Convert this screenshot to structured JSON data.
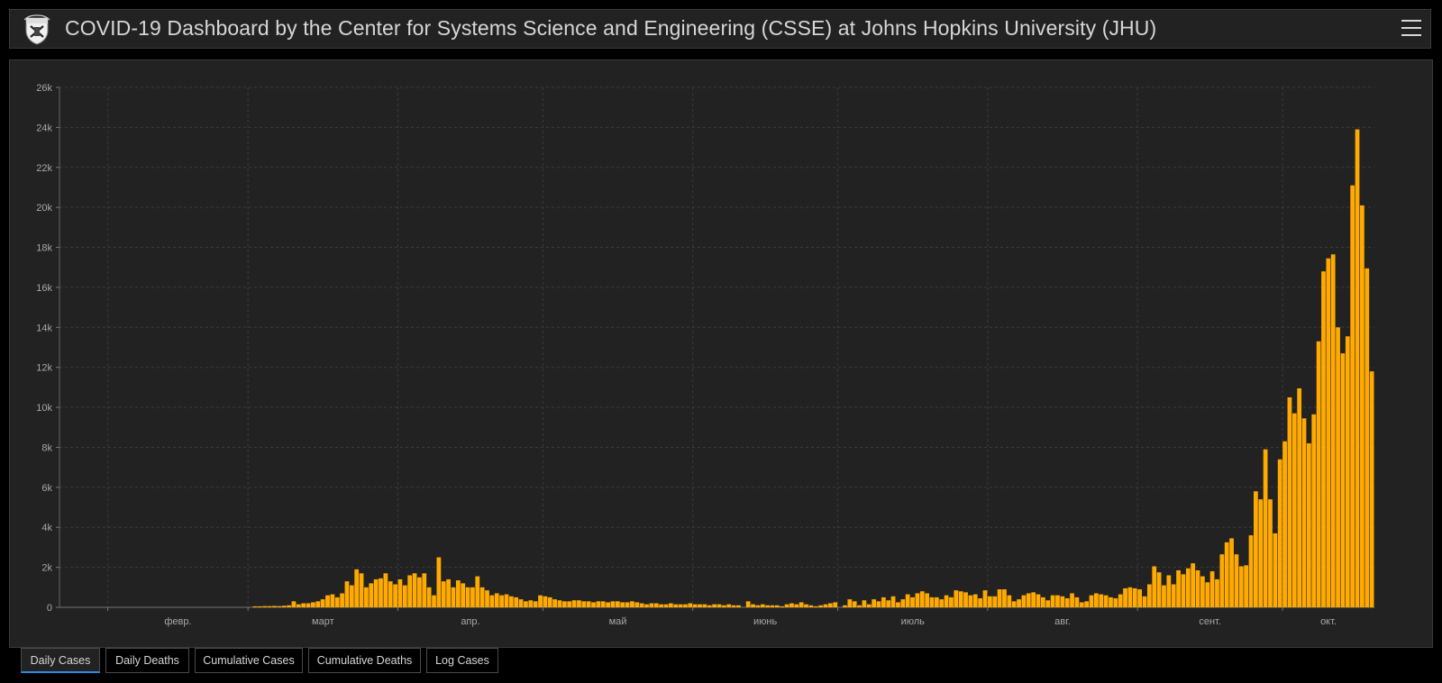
{
  "header": {
    "title": "COVID-19 Dashboard by the Center for Systems Science and Engineering (CSSE) at Johns Hopkins University (JHU)"
  },
  "icons": {
    "logo": "jhu-shield-logo",
    "menu": "hamburger-menu-icon"
  },
  "colors": {
    "bar": "#ffaa00",
    "background": "#222222",
    "tab_underline": "#2d8cdc"
  },
  "tabs": [
    {
      "label": "Daily Cases",
      "active": true
    },
    {
      "label": "Daily Deaths",
      "active": false
    },
    {
      "label": "Cumulative Cases",
      "active": false
    },
    {
      "label": "Cumulative Deaths",
      "active": false
    },
    {
      "label": "Log Cases",
      "active": false
    }
  ],
  "chart_data": {
    "type": "bar",
    "title": "",
    "xlabel": "",
    "ylabel": "",
    "ylim": [
      0,
      26000
    ],
    "yticks": [
      0,
      2000,
      4000,
      6000,
      8000,
      10000,
      12000,
      14000,
      16000,
      18000,
      20000,
      22000,
      24000,
      26000
    ],
    "ytick_labels": [
      "0",
      "2k",
      "4k",
      "6k",
      "8k",
      "10k",
      "12k",
      "14k",
      "16k",
      "18k",
      "20k",
      "22k",
      "24k",
      "26k"
    ],
    "x_start": "2020-01-22",
    "xticks": [
      {
        "date": "2020-02-01",
        "label": "февр."
      },
      {
        "date": "2020-03-01",
        "label": "март"
      },
      {
        "date": "2020-04-01",
        "label": "апр."
      },
      {
        "date": "2020-05-01",
        "label": "май"
      },
      {
        "date": "2020-06-01",
        "label": "июнь"
      },
      {
        "date": "2020-07-01",
        "label": "июль"
      },
      {
        "date": "2020-08-01",
        "label": "авг."
      },
      {
        "date": "2020-09-01",
        "label": "сент."
      },
      {
        "date": "2020-10-01",
        "label": "окт."
      }
    ],
    "grid": true,
    "bar_color": "#ffaa00",
    "values": [
      0,
      0,
      0,
      0,
      0,
      0,
      0,
      0,
      0,
      0,
      0,
      0,
      0,
      0,
      0,
      0,
      0,
      0,
      0,
      0,
      0,
      0,
      0,
      0,
      0,
      0,
      0,
      0,
      0,
      0,
      0,
      0,
      0,
      0,
      0,
      0,
      0,
      0,
      0,
      0,
      50,
      50,
      60,
      60,
      70,
      60,
      80,
      100,
      300,
      150,
      200,
      200,
      250,
      300,
      400,
      600,
      650,
      500,
      700,
      1300,
      1100,
      1900,
      1700,
      1000,
      1200,
      1400,
      1450,
      1700,
      1300,
      1150,
      1400,
      1100,
      1600,
      1700,
      1500,
      1700,
      1000,
      600,
      2500,
      1300,
      1400,
      1000,
      1350,
      1200,
      1000,
      1000,
      1550,
      1000,
      850,
      600,
      700,
      600,
      650,
      550,
      500,
      400,
      300,
      350,
      300,
      600,
      550,
      500,
      400,
      350,
      300,
      300,
      350,
      350,
      300,
      300,
      250,
      300,
      300,
      250,
      300,
      300,
      250,
      250,
      300,
      250,
      200,
      150,
      200,
      200,
      150,
      150,
      200,
      150,
      150,
      150,
      200,
      150,
      150,
      150,
      100,
      150,
      150,
      100,
      150,
      100,
      100,
      0,
      300,
      150,
      100,
      150,
      100,
      100,
      100,
      50,
      150,
      200,
      150,
      250,
      150,
      100,
      50,
      100,
      150,
      200,
      250,
      0,
      100,
      400,
      300,
      100,
      350,
      150,
      400,
      300,
      500,
      350,
      550,
      250,
      400,
      650,
      500,
      700,
      800,
      700,
      500,
      500,
      400,
      600,
      500,
      850,
      800,
      750,
      600,
      650,
      450,
      850,
      550,
      550,
      900,
      900,
      600,
      300,
      400,
      600,
      700,
      750,
      650,
      500,
      350,
      600,
      600,
      550,
      450,
      700,
      500,
      250,
      300,
      600,
      700,
      650,
      600,
      500,
      450,
      650,
      950,
      1000,
      950,
      900,
      550,
      1150,
      2050,
      1750,
      1100,
      1600,
      1150,
      1850,
      1650,
      1950,
      2200,
      1850,
      1550,
      1250,
      1800,
      1400,
      2650,
      3250,
      3450,
      2650,
      2050,
      2100,
      3600,
      5800,
      5400,
      7900,
      5400,
      3700,
      7400,
      8300,
      10500,
      9700,
      10950,
      9450,
      8200,
      9650,
      13300,
      16800,
      17450,
      17650,
      14000,
      12700,
      13550,
      21100,
      23900,
      20100,
      16950,
      11800
    ]
  }
}
